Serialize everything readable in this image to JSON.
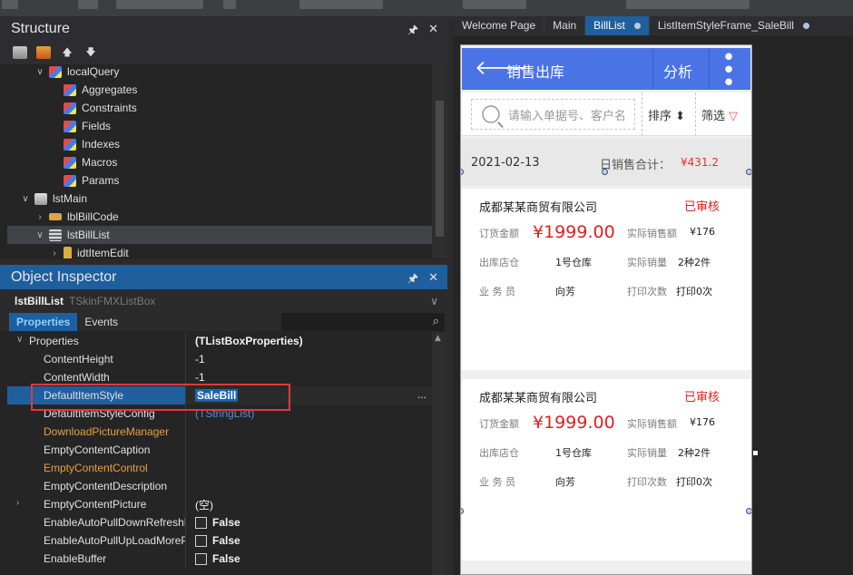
{
  "structure": {
    "title": "Structure",
    "pin": "🖈",
    "close": "✕",
    "toolbar_up": "🡅",
    "toolbar_down": "🡇",
    "tree": [
      {
        "label": "localQuery",
        "icon": "cube-icon",
        "indent": 1,
        "expand": "∨"
      },
      {
        "label": "Aggregates",
        "icon": "cube-icon",
        "indent": 2,
        "expand": ""
      },
      {
        "label": "Constraints",
        "icon": "cube-icon",
        "indent": 2,
        "expand": ""
      },
      {
        "label": "Fields",
        "icon": "cube-icon",
        "indent": 2,
        "expand": ""
      },
      {
        "label": "Indexes",
        "icon": "cube-icon",
        "indent": 2,
        "expand": ""
      },
      {
        "label": "Macros",
        "icon": "cube-icon",
        "indent": 2,
        "expand": ""
      },
      {
        "label": "Params",
        "icon": "cube-icon",
        "indent": 2,
        "expand": ""
      },
      {
        "label": "lstMain",
        "icon": "grid-icon",
        "indent": 0,
        "expand": "∨"
      },
      {
        "label": "lblBillCode",
        "icon": "label-icon",
        "indent": 1,
        "expand": "›"
      },
      {
        "label": "lstBillList",
        "icon": "list-icon",
        "indent": 1,
        "expand": "∨",
        "selected": true
      },
      {
        "label": "idtItemEdit",
        "icon": "item-icon",
        "indent": 2,
        "expand": "›"
      }
    ]
  },
  "inspector": {
    "title": "Object Inspector",
    "pin": "🖈",
    "close": "✕",
    "selected_name": "lstBillList",
    "selected_type": "TSkinFMXListBox",
    "tabs": [
      "Properties",
      "Events"
    ],
    "search_icon": "⌕",
    "properties": [
      {
        "name": "Properties",
        "value": "(TListBoxProperties)",
        "root": true,
        "expand": "∨",
        "style": "bold"
      },
      {
        "name": "ContentHeight",
        "value": "-1"
      },
      {
        "name": "ContentWidth",
        "value": "-1"
      },
      {
        "name": "DefaultItemStyle",
        "value": "SaleBill",
        "selected": true,
        "editor": "..."
      },
      {
        "name": "DefaultItemStyleConfig",
        "value": "(TStringList)",
        "style": "link"
      },
      {
        "name": "DownloadPictureManager",
        "value": "",
        "orange": true
      },
      {
        "name": "EmptyContentCaption",
        "value": ""
      },
      {
        "name": "EmptyContentControl",
        "value": "",
        "orange": true
      },
      {
        "name": "EmptyContentDescription",
        "value": ""
      },
      {
        "name": "EmptyContentPicture",
        "value": "(空)",
        "expand": "›"
      },
      {
        "name": "EnableAutoPullDownRefreshP",
        "value": "False",
        "checkbox": true
      },
      {
        "name": "EnableAutoPullUpLoadMoreP",
        "value": "False",
        "checkbox": true
      },
      {
        "name": "EnableBuffer",
        "value": "False",
        "checkbox": true
      }
    ]
  },
  "doc_tabs": [
    {
      "label": "Welcome Page"
    },
    {
      "label": "Main"
    },
    {
      "label": "BillList",
      "active": true,
      "dot": true
    },
    {
      "label": "ListItemStyleFrame_SaleBill",
      "dot": true
    }
  ],
  "form": {
    "back_icon": "🡐",
    "title": "销售出库",
    "analysis": "分析",
    "more_icon": "⋮",
    "search_placeholder": "请输入单据号、客户名",
    "sort_label": "排序",
    "sort_icon": "⬍",
    "filter_label": "筛选",
    "filter_icon": "▽",
    "date": "2021-02-13",
    "daily_label": "日销售合计：",
    "daily_total": "¥431.2",
    "cards": [
      {
        "company": "成都某某商贸有限公司",
        "status": "已审核",
        "order_amount_label": "订货金额",
        "order_amount": "¥1999.00",
        "actual_sales_label": "实际销售额",
        "actual_sales": "¥176",
        "warehouse_label": "出库店仓",
        "warehouse": "1号仓库",
        "actual_qty_label": "实际销量",
        "actual_qty": "2种2件",
        "clerk_label": "业 务 员",
        "clerk": "向芳",
        "print_label": "打印次数",
        "print": "打印0次"
      },
      {
        "company": "成都某某商贸有限公司",
        "status": "已审核",
        "order_amount_label": "订货金额",
        "order_amount": "¥1999.00",
        "actual_sales_label": "实际销售额",
        "actual_sales": "¥176",
        "warehouse_label": "出库店仓",
        "warehouse": "1号仓库",
        "actual_qty_label": "实际销量",
        "actual_qty": "2种2件",
        "clerk_label": "业 务 员",
        "clerk": "向芳",
        "print_label": "打印次数",
        "print": "打印0次"
      }
    ]
  },
  "colors": {
    "accent": "#1f5f9e",
    "app_bar": "#4a73e6",
    "highlight_box": "#e0393e",
    "price_red": "#e02020"
  }
}
